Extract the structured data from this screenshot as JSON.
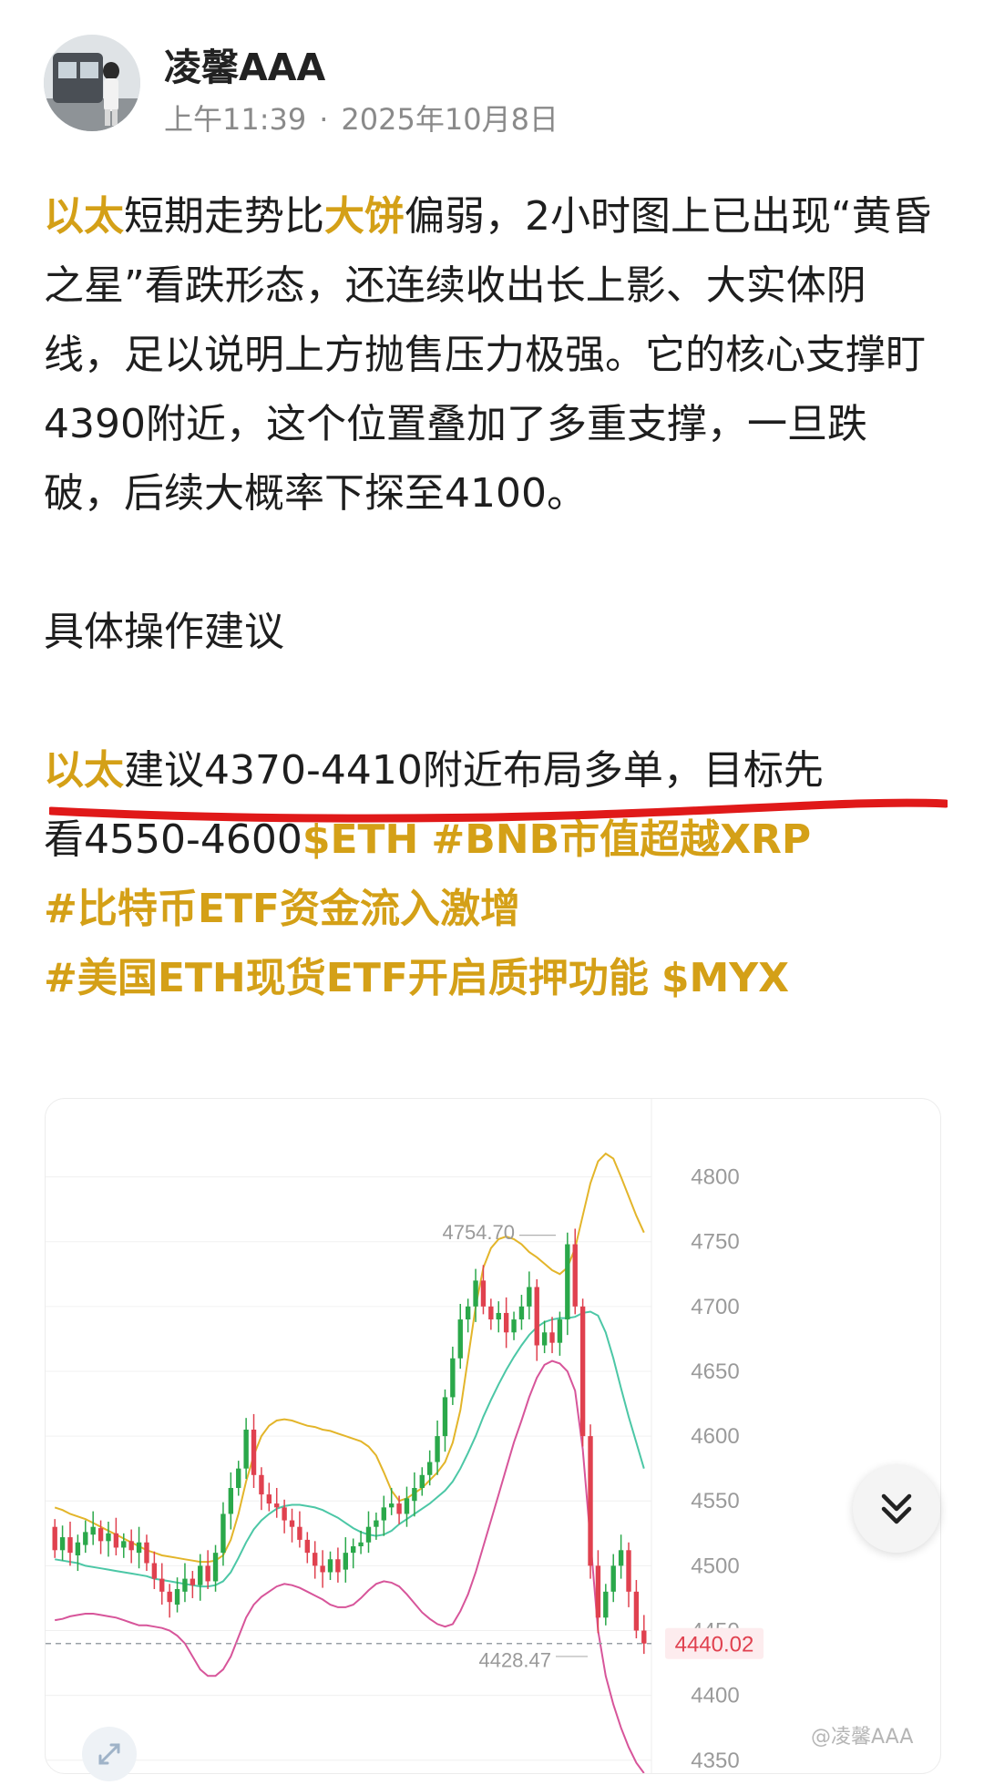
{
  "header": {
    "author": "凌馨AAA",
    "time": "上午11:39",
    "separator": "·",
    "date": "2025年10月8日"
  },
  "post": {
    "p1": {
      "kw1": "以太",
      "t1": "短期走势比",
      "kw2": "大饼",
      "t2": "偏弱，2小时图上已出现“黄昏之星”看跌形态，还连续收出长上影、大实体阴线，足以说明上方抛售压力极强。它的核心支撑盯4390附近，这个位置叠加了多重支撑，一旦跌破，后续大概率下探至4100。"
    },
    "p2": "具体操作建议",
    "p3": {
      "kw": "以太",
      "t1": "建议4370-4410附近布局多单，目标先",
      "t2": "看4550-4600",
      "tag1": "$ETH",
      "tag2": "#BNB市值超越XRP",
      "tag3": "#比特币ETF资金流入激增",
      "tag4": "#美国ETH现货ETF开启质押功能",
      "tag5": "$MYX"
    }
  },
  "colors": {
    "accent": "#d4a017",
    "underline": "#e01919",
    "candle_up": "#2aa84a",
    "candle_down": "#e0414f",
    "band_upper": "#e3b52a",
    "band_mid": "#4cc7a6",
    "band_lower": "#d7559a",
    "price_tag": "#e0414f"
  },
  "chart_data": {
    "type": "candlestick",
    "y_ticks": [
      "4800",
      "4750",
      "4700",
      "4650",
      "4600",
      "4550",
      "4500",
      "4450",
      "4400",
      "4350"
    ],
    "ylim": [
      4340,
      4825
    ],
    "high_label": "4754.70",
    "low_label": "4428.47",
    "last_price": "4440.02",
    "watermark": "@凌馨AAA",
    "series": [
      {
        "name": "upper",
        "values": [
          4545,
          4543,
          4540,
          4538,
          4536,
          4533,
          4530,
          4527,
          4524,
          4521,
          4518,
          4515,
          4512,
          4510,
          4508,
          4507,
          4506,
          4505,
          4504,
          4503,
          4503,
          4504,
          4508,
          4520,
          4540,
          4565,
          4585,
          4600,
          4608,
          4612,
          4613,
          4612,
          4610,
          4608,
          4607,
          4605,
          4604,
          4602,
          4600,
          4598,
          4596,
          4592,
          4585,
          4572,
          4558,
          4550,
          4552,
          4556,
          4560,
          4566,
          4572,
          4580,
          4595,
          4620,
          4660,
          4700,
          4730,
          4745,
          4752,
          4754,
          4752,
          4748,
          4742,
          4738,
          4733,
          4728,
          4725,
          4730,
          4745,
          4770,
          4795,
          4812,
          4818,
          4814,
          4800,
          4785,
          4770,
          4757
        ]
      },
      {
        "name": "middle",
        "values": [
          4505,
          4504,
          4503,
          4502,
          4500,
          4499,
          4498,
          4497,
          4496,
          4495,
          4494,
          4493,
          4492,
          4490,
          4489,
          4488,
          4487,
          4486,
          4485,
          4484,
          4484,
          4485,
          4488,
          4495,
          4506,
          4518,
          4528,
          4535,
          4540,
          4544,
          4546,
          4547,
          4547,
          4546,
          4545,
          4543,
          4540,
          4537,
          4533,
          4529,
          4526,
          4524,
          4523,
          4524,
          4527,
          4532,
          4536,
          4540,
          4544,
          4548,
          4553,
          4558,
          4565,
          4575,
          4587,
          4600,
          4615,
          4628,
          4640,
          4651,
          4661,
          4670,
          4678,
          4684,
          4688,
          4690,
          4691,
          4691,
          4692,
          4695,
          4696,
          4693,
          4680,
          4660,
          4637,
          4615,
          4595,
          4575
        ]
      },
      {
        "name": "lower",
        "values": [
          4458,
          4459,
          4461,
          4462,
          4463,
          4463,
          4462,
          4461,
          4460,
          4458,
          4456,
          4454,
          4454,
          4453,
          4452,
          4450,
          4446,
          4440,
          4430,
          4420,
          4415,
          4415,
          4420,
          4430,
          4445,
          4460,
          4470,
          4476,
          4480,
          4484,
          4486,
          4485,
          4483,
          4480,
          4477,
          4474,
          4470,
          4468,
          4468,
          4470,
          4475,
          4481,
          4486,
          4488,
          4487,
          4484,
          4478,
          4471,
          4464,
          4459,
          4455,
          4453,
          4455,
          4465,
          4478,
          4495,
          4515,
          4535,
          4555,
          4575,
          4595,
          4612,
          4630,
          4645,
          4655,
          4658,
          4656,
          4650,
          4635,
          4590,
          4520,
          4450,
          4415,
          4393,
          4375,
          4360,
          4348,
          4340
        ]
      }
    ],
    "candles": [
      [
        4530,
        4512
      ],
      [
        4512,
        4522
      ],
      [
        4522,
        4510
      ],
      [
        4508,
        4518
      ],
      [
        4516,
        4526
      ],
      [
        4524,
        4530
      ],
      [
        4529,
        4519
      ],
      [
        4519,
        4525
      ],
      [
        4525,
        4514
      ],
      [
        4514,
        4519
      ],
      [
        4519,
        4512
      ],
      [
        4510,
        4518
      ],
      [
        4518,
        4502
      ],
      [
        4502,
        4490
      ],
      [
        4490,
        4480
      ],
      [
        4480,
        4472
      ],
      [
        4470,
        4482
      ],
      [
        4480,
        4490
      ],
      [
        4490,
        4485
      ],
      [
        4485,
        4500
      ],
      [
        4500,
        4488
      ],
      [
        4488,
        4510
      ],
      [
        4510,
        4540
      ],
      [
        4540,
        4560
      ],
      [
        4560,
        4575
      ],
      [
        4575,
        4605
      ],
      [
        4605,
        4570
      ],
      [
        4570,
        4555
      ],
      [
        4555,
        4548
      ],
      [
        4548,
        4545
      ],
      [
        4545,
        4535
      ],
      [
        4535,
        4530
      ],
      [
        4530,
        4520
      ],
      [
        4520,
        4510
      ],
      [
        4510,
        4500
      ],
      [
        4500,
        4495
      ],
      [
        4495,
        4505
      ],
      [
        4505,
        4495
      ],
      [
        4497,
        4510
      ],
      [
        4510,
        4515
      ],
      [
        4515,
        4518
      ],
      [
        4518,
        4530
      ],
      [
        4530,
        4535
      ],
      [
        4535,
        4545
      ],
      [
        4545,
        4548
      ],
      [
        4548,
        4540
      ],
      [
        4540,
        4552
      ],
      [
        4550,
        4560
      ],
      [
        4560,
        4570
      ],
      [
        4570,
        4580
      ],
      [
        4580,
        4600
      ],
      [
        4600,
        4630
      ],
      [
        4630,
        4660
      ],
      [
        4660,
        4690
      ],
      [
        4690,
        4700
      ],
      [
        4700,
        4720
      ],
      [
        4720,
        4700
      ],
      [
        4700,
        4690
      ],
      [
        4690,
        4695
      ],
      [
        4695,
        4680
      ],
      [
        4680,
        4690
      ],
      [
        4690,
        4700
      ],
      [
        4700,
        4715
      ],
      [
        4715,
        4670
      ],
      [
        4670,
        4680
      ],
      [
        4680,
        4672
      ],
      [
        4672,
        4690
      ],
      [
        4690,
        4748
      ],
      [
        4748,
        4700
      ],
      [
        4700,
        4600
      ],
      [
        4600,
        4500
      ],
      [
        4500,
        4460
      ],
      [
        4460,
        4480
      ],
      [
        4480,
        4500
      ],
      [
        4500,
        4512
      ],
      [
        4512,
        4480
      ],
      [
        4480,
        4450
      ],
      [
        4450,
        4440
      ]
    ]
  },
  "controls": {
    "scroll_down_icon": "double-chevron-down-icon",
    "expand_icon": "expand-arrows-icon"
  }
}
